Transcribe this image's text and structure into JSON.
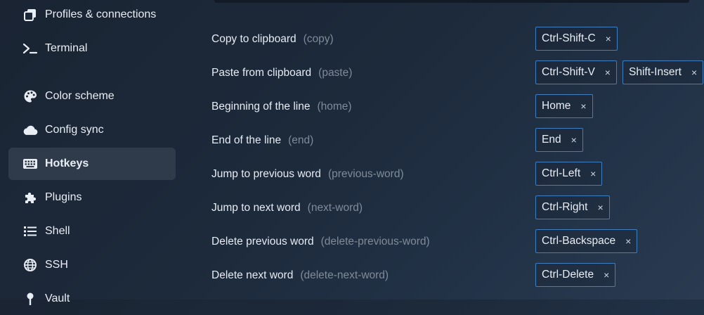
{
  "sidebar": {
    "items": [
      {
        "label": "Profiles & connections",
        "icon": "window-stack-icon"
      },
      {
        "label": "Terminal",
        "icon": "terminal-prompt-icon"
      },
      {
        "label": "Color scheme",
        "icon": "palette-icon"
      },
      {
        "label": "Config sync",
        "icon": "cloud-icon"
      },
      {
        "label": "Hotkeys",
        "icon": "keyboard-icon",
        "active": true
      },
      {
        "label": "Plugins",
        "icon": "puzzle-icon"
      },
      {
        "label": "Shell",
        "icon": "list-icon"
      },
      {
        "label": "SSH",
        "icon": "globe-icon"
      },
      {
        "label": "Vault",
        "icon": "key-icon"
      }
    ]
  },
  "hotkeys": [
    {
      "name": "Copy to clipboard",
      "id": "(copy)",
      "keys": [
        "Ctrl-Shift-C"
      ]
    },
    {
      "name": "Paste from clipboard",
      "id": "(paste)",
      "keys": [
        "Ctrl-Shift-V",
        "Shift-Insert"
      ]
    },
    {
      "name": "Beginning of the line",
      "id": "(home)",
      "keys": [
        "Home"
      ]
    },
    {
      "name": "End of the line",
      "id": "(end)",
      "keys": [
        "End"
      ]
    },
    {
      "name": "Jump to previous word",
      "id": "(previous-word)",
      "keys": [
        "Ctrl-Left"
      ]
    },
    {
      "name": "Jump to next word",
      "id": "(next-word)",
      "keys": [
        "Ctrl-Right"
      ]
    },
    {
      "name": "Delete previous word",
      "id": "(delete-previous-word)",
      "keys": [
        "Ctrl-Backspace"
      ]
    },
    {
      "name": "Delete next word",
      "id": "(delete-next-word)",
      "keys": [
        "Ctrl-Delete"
      ]
    }
  ],
  "ui": {
    "remove_symbol": "×",
    "active_background": "#2f3b4b",
    "chip_border_color": "#3d7fc0",
    "muted_text_color": "#7f8b9a"
  }
}
